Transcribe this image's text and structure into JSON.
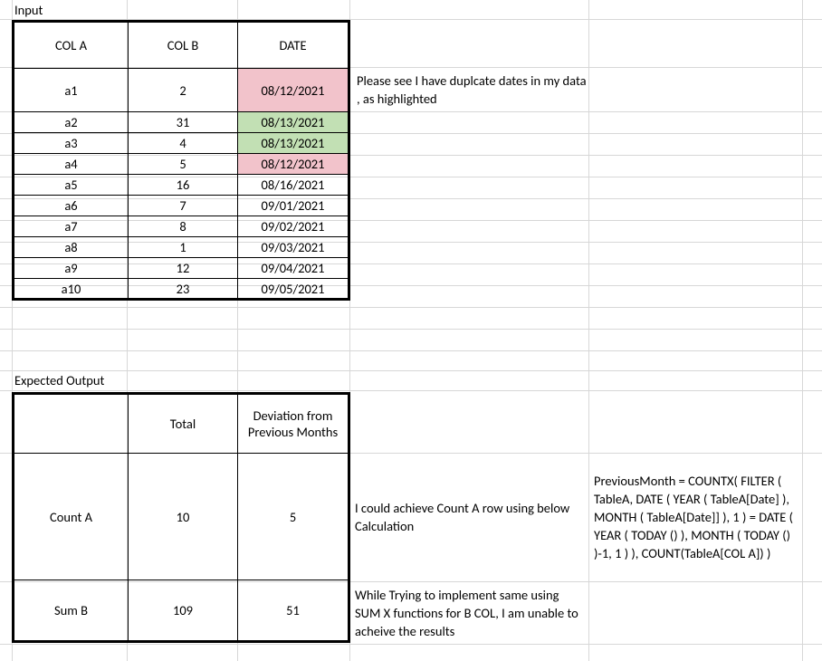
{
  "labels": {
    "input": "Input",
    "expected_output": "Expected Output"
  },
  "input_table": {
    "headers": {
      "colA": "COL A",
      "colB": "COL B",
      "date": "DATE"
    },
    "rows": [
      {
        "a": "a1",
        "b": "2",
        "date": "08/12/2021",
        "hl": "pink",
        "tall": true
      },
      {
        "a": "a2",
        "b": "31",
        "date": "08/13/2021",
        "hl": "green"
      },
      {
        "a": "a3",
        "b": "4",
        "date": "08/13/2021",
        "hl": "green"
      },
      {
        "a": "a4",
        "b": "5",
        "date": "08/12/2021",
        "hl": "pink"
      },
      {
        "a": "a5",
        "b": "16",
        "date": "08/16/2021"
      },
      {
        "a": "a6",
        "b": "7",
        "date": "09/01/2021"
      },
      {
        "a": "a7",
        "b": "8",
        "date": "09/02/2021"
      },
      {
        "a": "a8",
        "b": "1",
        "date": "09/03/2021"
      },
      {
        "a": "a9",
        "b": "12",
        "date": "09/04/2021"
      },
      {
        "a": "a10",
        "b": "23",
        "date": "09/05/2021"
      }
    ]
  },
  "notes": {
    "duplicate": "Please see I have duplcate dates in my data , as highlighted",
    "count_a": "I could achieve Count A row using below Calculation",
    "sum_b": "While Trying to implement same using SUM X functions for B COL, I am unable to acheive the results",
    "formula": "PreviousMonth = COUNTX( FILTER ( TableA, DATE ( YEAR ( TableA[Date] ), MONTH ( TableA[Date]] ), 1 ) = DATE ( YEAR ( TODAY () ), MONTH ( TODAY () )-1, 1 ) ), COUNT(TableA[COL A]) )"
  },
  "output_table": {
    "headers": {
      "blank": "",
      "total": "Total",
      "deviation": "Deviation from Previous Months"
    },
    "rows": [
      {
        "label": "Count A",
        "total": "10",
        "deviation": "5"
      },
      {
        "label": "Sum B",
        "total": "109",
        "deviation": "51"
      }
    ]
  }
}
